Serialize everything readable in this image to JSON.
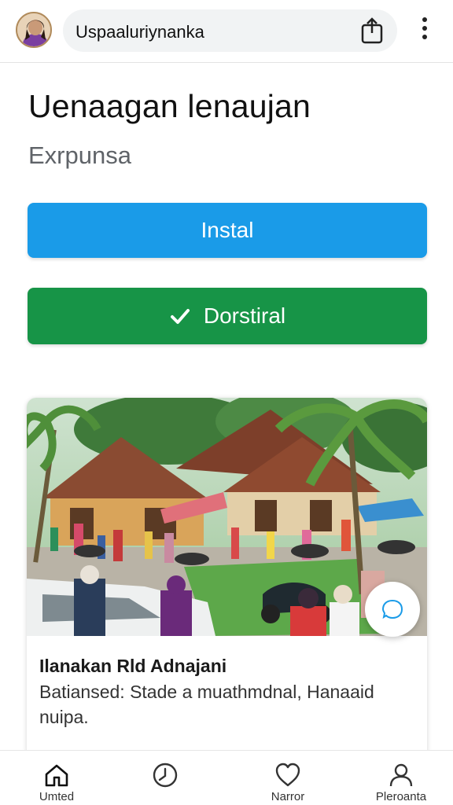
{
  "top_bar": {
    "url_text": "Uspaaluriynanka",
    "avatar_icon": "user-avatar",
    "share_icon": "share-icon",
    "menu_icon": "more-vert-icon"
  },
  "header": {
    "title": "Uenaagan lenaujan",
    "subtitle": "Exrpunsa"
  },
  "actions": {
    "install_label": "Instal",
    "done_label": "Dorstiral",
    "install_color": "#1a9be8",
    "done_color": "#179447"
  },
  "card": {
    "image_icon": "village-market-photo",
    "title": "Ilanakan Rld Adnajani",
    "description": "Batiansed: Stade a muathmdnal, Hanaaid nuipa.",
    "fab_icon": "chat-bubble-icon"
  },
  "bottom_nav": {
    "items": [
      {
        "label": "Umted",
        "icon": "home-icon"
      },
      {
        "label": "",
        "icon": "clock-icon"
      },
      {
        "label": "Narror",
        "icon": "heart-icon"
      },
      {
        "label": "Pleroanta",
        "icon": "person-icon"
      }
    ]
  }
}
